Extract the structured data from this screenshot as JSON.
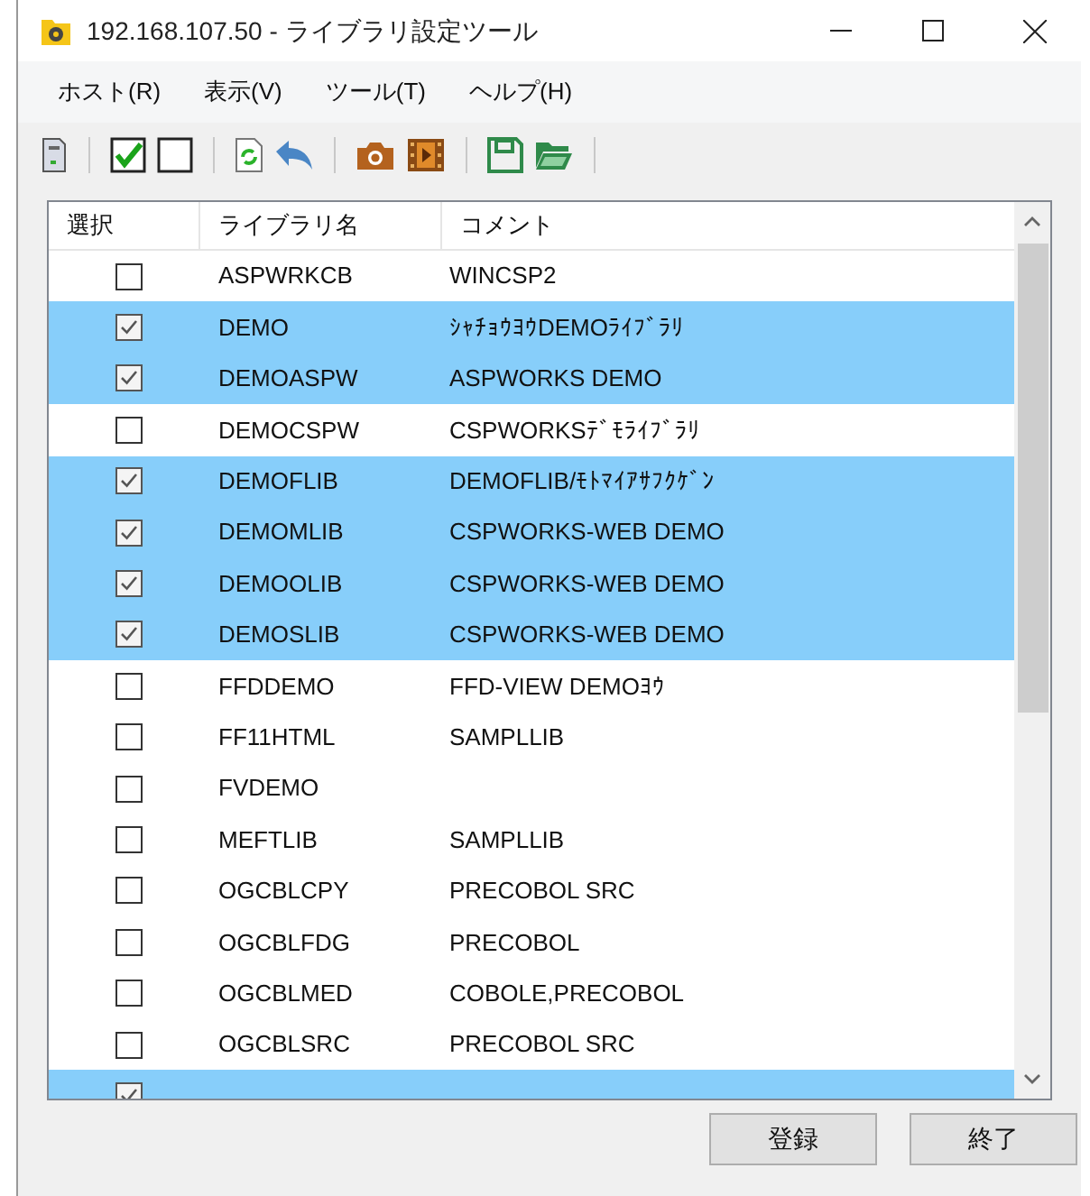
{
  "window": {
    "title": "192.168.107.50 - ライブラリ設定ツール"
  },
  "menu": [
    "ホスト(R)",
    "表示(V)",
    "ツール(T)",
    "ヘルプ(H)"
  ],
  "table": {
    "columns": [
      "選択",
      "ライブラリ名",
      "コメント"
    ],
    "rows": [
      {
        "checked": false,
        "name": "ASPWRKCB",
        "comment": "WINCSP2"
      },
      {
        "checked": true,
        "name": "DEMO",
        "comment": "ｼｬﾁｮｳﾖｳDEMOﾗｲﾌﾞﾗﾘ"
      },
      {
        "checked": true,
        "name": "DEMOASPW",
        "comment": "ASPWORKS DEMO"
      },
      {
        "checked": false,
        "name": "DEMOCSPW",
        "comment": "CSPWORKSﾃﾞﾓﾗｲﾌﾞﾗﾘ"
      },
      {
        "checked": true,
        "name": "DEMOFLIB",
        "comment": "DEMOFLIB/ﾓﾄﾏｲｱｻﾌｸｹﾞﾝ"
      },
      {
        "checked": true,
        "name": "DEMOMLIB",
        "comment": "CSPWORKS-WEB DEMO"
      },
      {
        "checked": true,
        "name": "DEMOOLIB",
        "comment": "CSPWORKS-WEB DEMO"
      },
      {
        "checked": true,
        "name": "DEMOSLIB",
        "comment": "CSPWORKS-WEB DEMO"
      },
      {
        "checked": false,
        "name": "FFDDEMO",
        "comment": "FFD-VIEW DEMOﾖｳ"
      },
      {
        "checked": false,
        "name": "FF11HTML",
        "comment": "SAMPLLIB"
      },
      {
        "checked": false,
        "name": "FVDEMO"
      },
      {
        "checked": false,
        "name": "MEFTLIB",
        "comment": "SAMPLLIB"
      },
      {
        "checked": false,
        "name": "OGCBLCPY",
        "comment": "PRECOBOL SRC"
      },
      {
        "checked": false,
        "name": "OGCBLFDG",
        "comment": "PRECOBOL"
      },
      {
        "checked": false,
        "name": "OGCBLMED",
        "comment": "COBOLE,PRECOBOL"
      },
      {
        "checked": false,
        "name": "OGCBLSRC",
        "comment": "PRECOBOL SRC"
      },
      {
        "checked": true
      }
    ]
  },
  "buttons": [
    "登録",
    "終了"
  ]
}
